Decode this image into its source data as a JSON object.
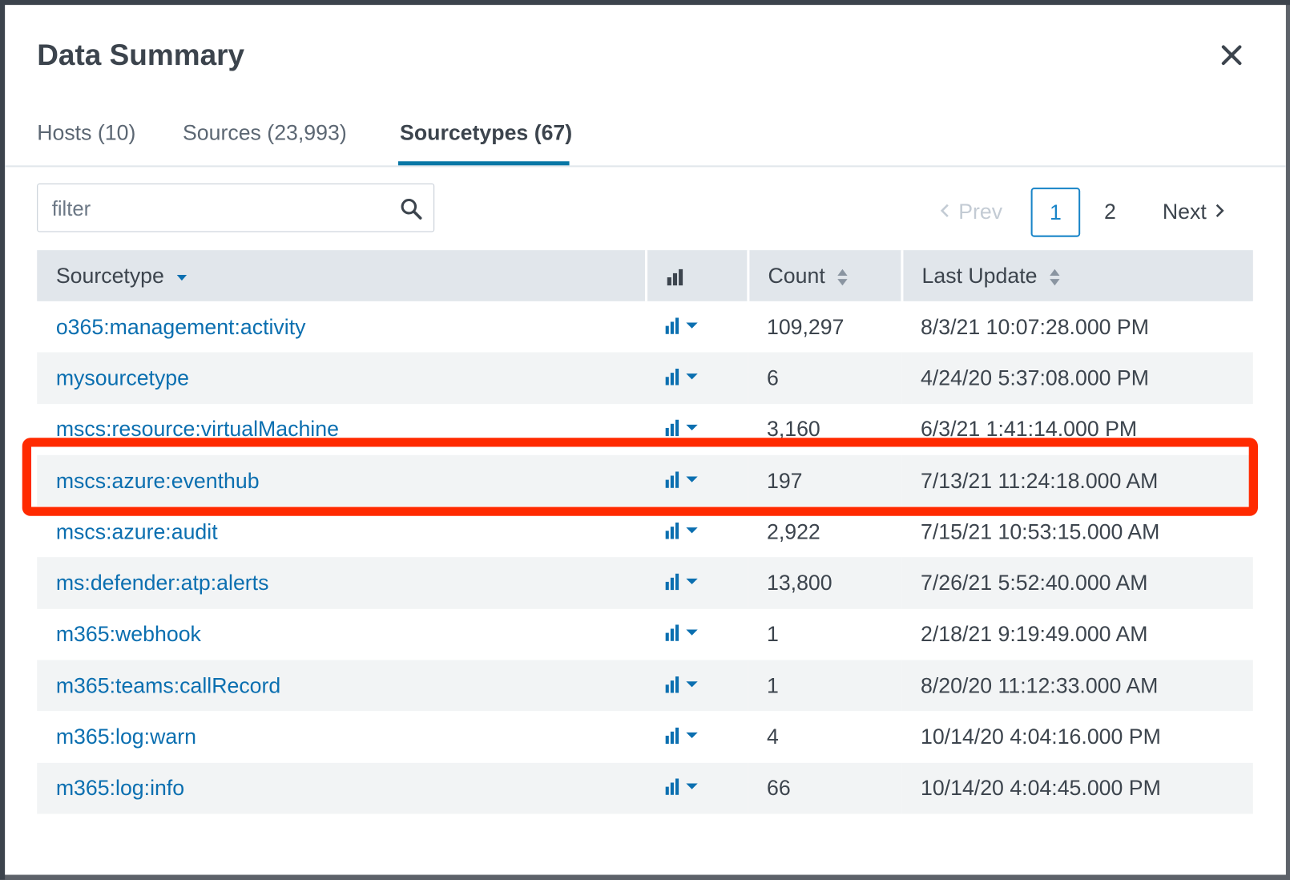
{
  "modal": {
    "title": "Data Summary",
    "close_icon": "close-icon"
  },
  "tabs": [
    {
      "label": "Hosts (10)",
      "active": false
    },
    {
      "label": "Sources (23,993)",
      "active": false
    },
    {
      "label": "Sourcetypes (67)",
      "active": true
    }
  ],
  "filter": {
    "placeholder": "filter",
    "value": ""
  },
  "pagination": {
    "prev": "Prev",
    "pages": [
      "1",
      "2"
    ],
    "current": "1",
    "next": "Next"
  },
  "table": {
    "columns": [
      "Sourcetype",
      "",
      "Count",
      "Last Update"
    ],
    "sorted_column": "Sourcetype",
    "rows": [
      {
        "sourcetype": "o365:management:activity",
        "count": "109,297",
        "last_update": "8/3/21 10:07:28.000 PM"
      },
      {
        "sourcetype": "mysourcetype",
        "count": "6",
        "last_update": "4/24/20 5:37:08.000 PM"
      },
      {
        "sourcetype": "mscs:resource:virtualMachine",
        "count": "3,160",
        "last_update": "6/3/21 1:41:14.000 PM"
      },
      {
        "sourcetype": "mscs:azure:eventhub",
        "count": "197",
        "last_update": "7/13/21 11:24:18.000 AM",
        "highlighted": true
      },
      {
        "sourcetype": "mscs:azure:audit",
        "count": "2,922",
        "last_update": "7/15/21 10:53:15.000 AM"
      },
      {
        "sourcetype": "ms:defender:atp:alerts",
        "count": "13,800",
        "last_update": "7/26/21 5:52:40.000 AM"
      },
      {
        "sourcetype": "m365:webhook",
        "count": "1",
        "last_update": "2/18/21 9:19:49.000 AM"
      },
      {
        "sourcetype": "m365:teams:callRecord",
        "count": "1",
        "last_update": "8/20/20 11:12:33.000 AM"
      },
      {
        "sourcetype": "m365:log:warn",
        "count": "4",
        "last_update": "10/14/20 4:04:16.000 PM"
      },
      {
        "sourcetype": "m365:log:info",
        "count": "66",
        "last_update": "10/14/20 4:04:45.000 PM"
      }
    ]
  },
  "colors": {
    "accent": "#0877a6",
    "link": "#0b6fb0",
    "highlight": "#ff2a00",
    "header_bg": "#e1e6eb",
    "row_alt": "#f2f4f5"
  }
}
